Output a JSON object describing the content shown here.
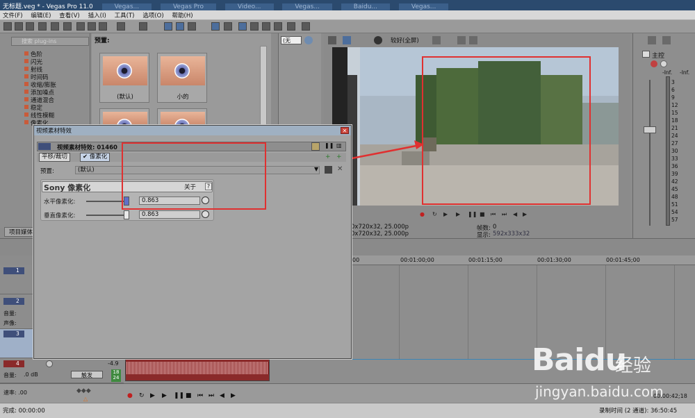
{
  "window": {
    "title": "无标题.veg * - Vegas Pro 11.0",
    "taskbar_tabs": [
      "Vegas...",
      "Vegas Pro",
      "Video...",
      "Vegas...",
      "Baidu...",
      "Vegas..."
    ]
  },
  "menu": [
    "文件(F)",
    "编辑(E)",
    "查看(V)",
    "插入(I)",
    "工具(T)",
    "选项(O)",
    "帮助(H)"
  ],
  "explorer": {
    "search_placeholder": "搜索 plug-ins",
    "items": [
      "色阶",
      "闪光",
      "射线",
      "时间码",
      "收缩/膨胀",
      "添加噪点",
      "通道混合",
      "稳定",
      "线性模糊",
      "像素化"
    ],
    "bottom_tab": "项目媒体"
  },
  "presets_panel": {
    "label": "预置:",
    "thumbs": [
      {
        "label": "(默认)"
      },
      {
        "label": "小的"
      }
    ]
  },
  "middle": {
    "combo": "(无"
  },
  "preview": {
    "quality": "较好(全屏)",
    "project_line1": "0x720x32, 25.000p",
    "project_line2": "0x720x32, 25.000p",
    "frame_label": "帧数:",
    "frame_value": "0",
    "display_label": "显示:",
    "display_value": "592x333x32"
  },
  "meter": {
    "master_label": "主控",
    "inf1": "-Inf.",
    "inf2": "-Inf.",
    "db_ticks": [
      "3",
      "6",
      "9",
      "12",
      "15",
      "18",
      "21",
      "24",
      "27",
      "30",
      "33",
      "36",
      "39",
      "42",
      "45",
      "48",
      "51",
      "54",
      "57"
    ]
  },
  "timeline": {
    "ruler": [
      "00",
      "00:01:00;00",
      "00:01:15;00",
      "00:01:30;00",
      "00:01:45;00"
    ],
    "tracks": [
      {
        "num": "1"
      },
      {
        "num": "2"
      },
      {
        "num": "3"
      },
      {
        "num": "4"
      }
    ],
    "audio_volume_label": "音量:",
    "audio_pan_label": "声像:",
    "audio_db": "-4.9",
    "audio_vol_value": ".0 dB",
    "touch_label": "触发",
    "meter_18": "18",
    "meter_24": "24",
    "rate_label": "速率: .00",
    "end_time": "00:00:42;18"
  },
  "status": {
    "left": "完成: 00:00:00",
    "right": "录制时间 (2 通道): 36:50:45"
  },
  "dialog": {
    "title": "视频素材特效",
    "header_text": "视频素材特效: 01460",
    "chain_pan": "平移/裁切",
    "chain_pixelate": "像素化",
    "preset_label": "预置:",
    "preset_value": "(默认)",
    "plugin_name": "Sony 像素化",
    "about": "关于",
    "help": "?",
    "param1_label": "水平像素化:",
    "param1_value": "0.863",
    "param2_label": "垂直像素化:",
    "param2_value": "0.863"
  },
  "watermark": {
    "logo": "Bai\u0000du",
    "logo_text": "Baidu",
    "cn": "经验",
    "url": "jingyan.baidu.com"
  },
  "colors": {
    "annotation": "#e03030",
    "accent": "#3a86b8"
  }
}
